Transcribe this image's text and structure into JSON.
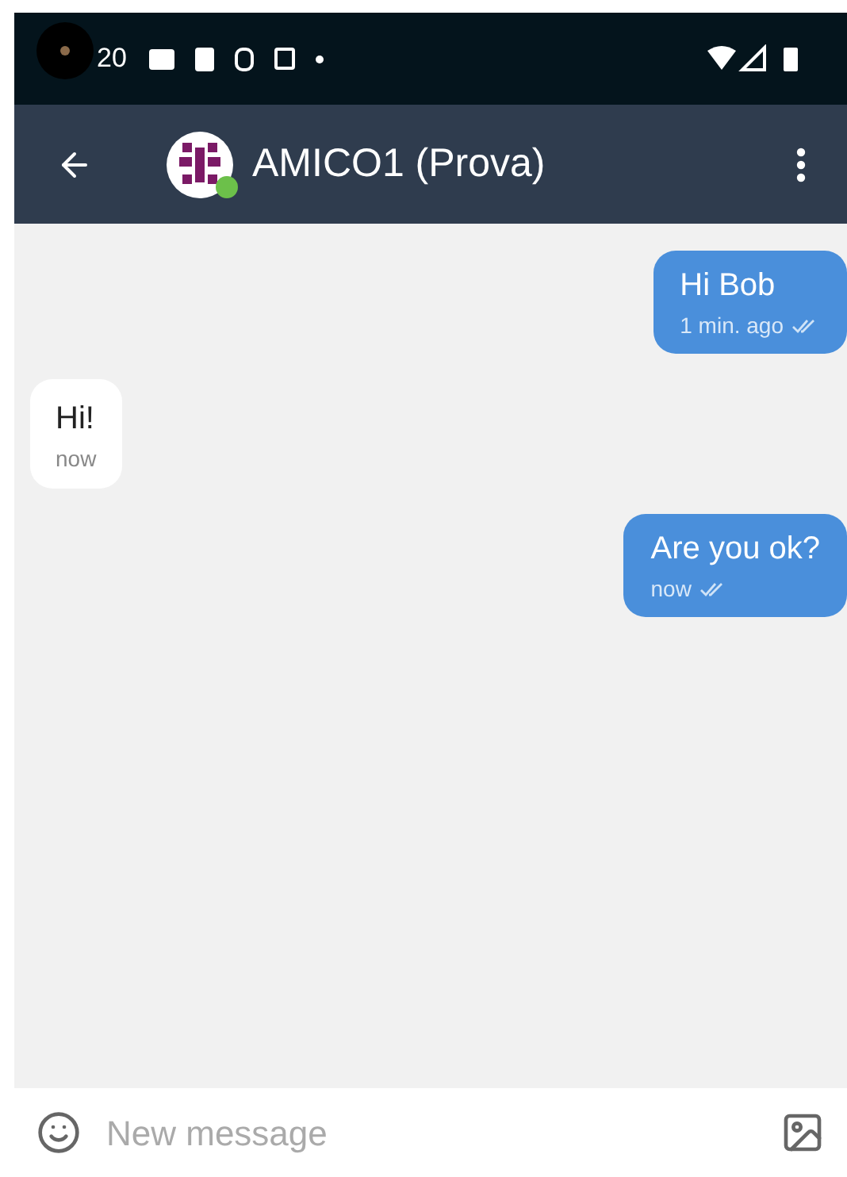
{
  "status_bar": {
    "time": "20"
  },
  "header": {
    "title": "AMICO1 (Prova)",
    "online": true
  },
  "messages": [
    {
      "kind": "outgoing",
      "text": "Hi Bob",
      "time": "1 min. ago"
    },
    {
      "kind": "incoming",
      "text": "Hi!",
      "time": "now"
    },
    {
      "kind": "outgoing",
      "text": "Are you ok?",
      "time": "now"
    }
  ],
  "composer": {
    "placeholder": "New message"
  }
}
